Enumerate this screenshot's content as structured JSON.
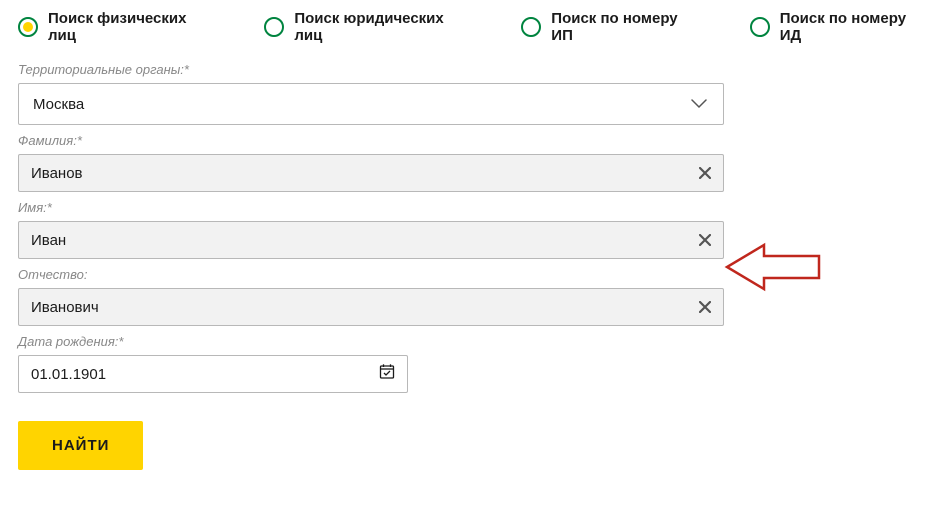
{
  "tabs": {
    "items": [
      {
        "label": "Поиск физических лиц",
        "selected": true
      },
      {
        "label": "Поиск юридических лиц",
        "selected": false
      },
      {
        "label": "Поиск по номеру ИП",
        "selected": false
      },
      {
        "label": "Поиск по номеру ИД",
        "selected": false
      }
    ]
  },
  "labels": {
    "territorial": "Территориальные органы:*",
    "lastname": "Фамилия:*",
    "firstname": "Имя:*",
    "patronymic": "Отчество:",
    "dob": "Дата рождения:*"
  },
  "values": {
    "territorial": "Москва",
    "lastname": "Иванов",
    "firstname": "Иван",
    "patronymic": "Иванович",
    "dob": "01.01.1901"
  },
  "button": {
    "submit": "НАЙТИ"
  },
  "colors": {
    "accent_green": "#00843f",
    "accent_yellow": "#ffd400"
  }
}
